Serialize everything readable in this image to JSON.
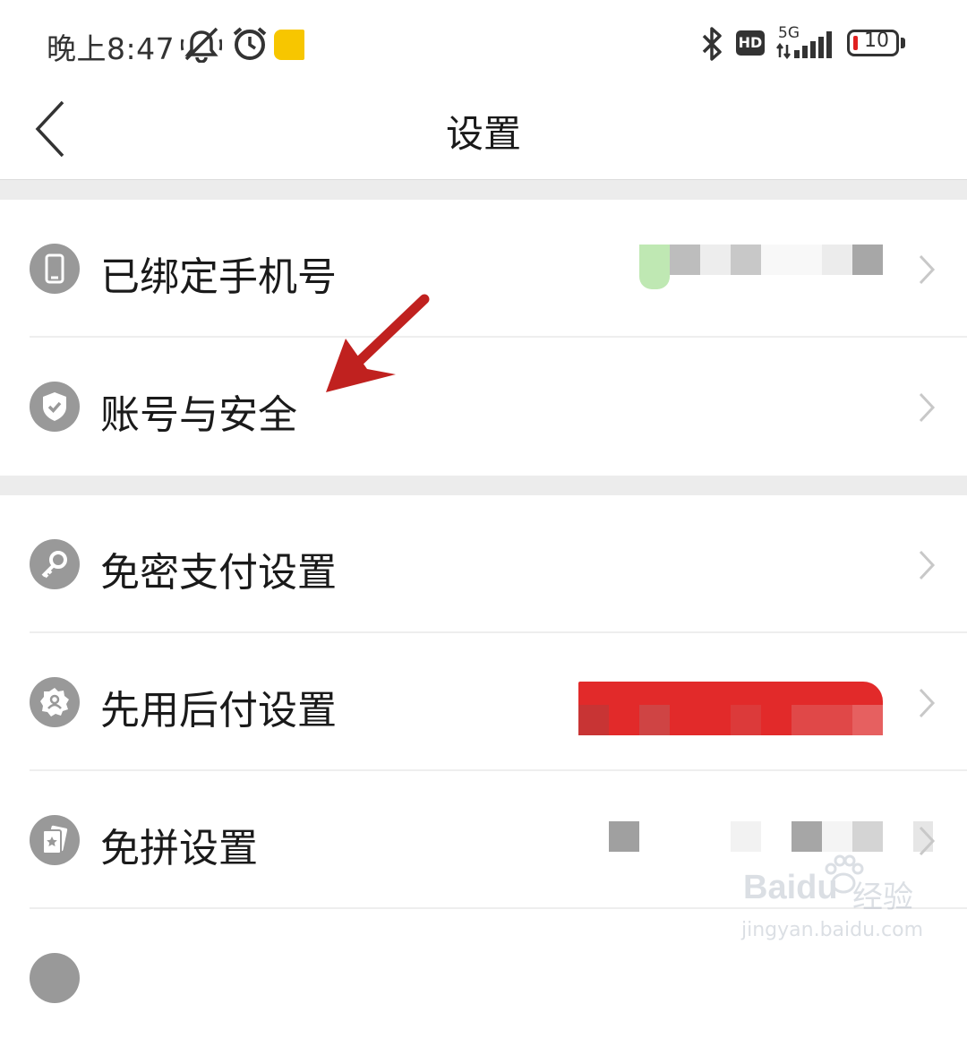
{
  "status_bar": {
    "time": "晚上8:47",
    "icons": [
      "mute-icon",
      "alarm-icon",
      "notification-icon",
      "bluetooth-icon",
      "hd-icon",
      "signal-icon",
      "battery-icon"
    ],
    "hd": "HD",
    "network": "5G",
    "battery": "10",
    "battery_low_color": "#e02020"
  },
  "header": {
    "back_icon": "chevron-left-icon",
    "title": "设置"
  },
  "sections": [
    {
      "items": [
        {
          "icon": "phone-icon",
          "label": "已绑定手机号",
          "value": "",
          "chevron": "chevron-right-icon"
        },
        {
          "icon": "shield-check-icon",
          "label": "账号与安全",
          "chevron": "chevron-right-icon"
        }
      ]
    },
    {
      "items": [
        {
          "icon": "key-icon",
          "label": "免密支付设置",
          "chevron": "chevron-right-icon"
        },
        {
          "icon": "badge-user-icon",
          "label": "先用后付设置",
          "value": "",
          "chevron": "chevron-right-icon"
        },
        {
          "icon": "card-star-icon",
          "label": "免拼设置",
          "value": "",
          "chevron": "chevron-right-icon"
        },
        {
          "icon": "partial-icon",
          "label": "",
          "chevron": ""
        }
      ]
    }
  ],
  "annotation": {
    "type": "arrow",
    "color": "#c0211f",
    "points_to": "账号与安全"
  },
  "watermark": {
    "logo": "Baidu",
    "brand": "经验",
    "url": "jingyan.baidu.com"
  }
}
